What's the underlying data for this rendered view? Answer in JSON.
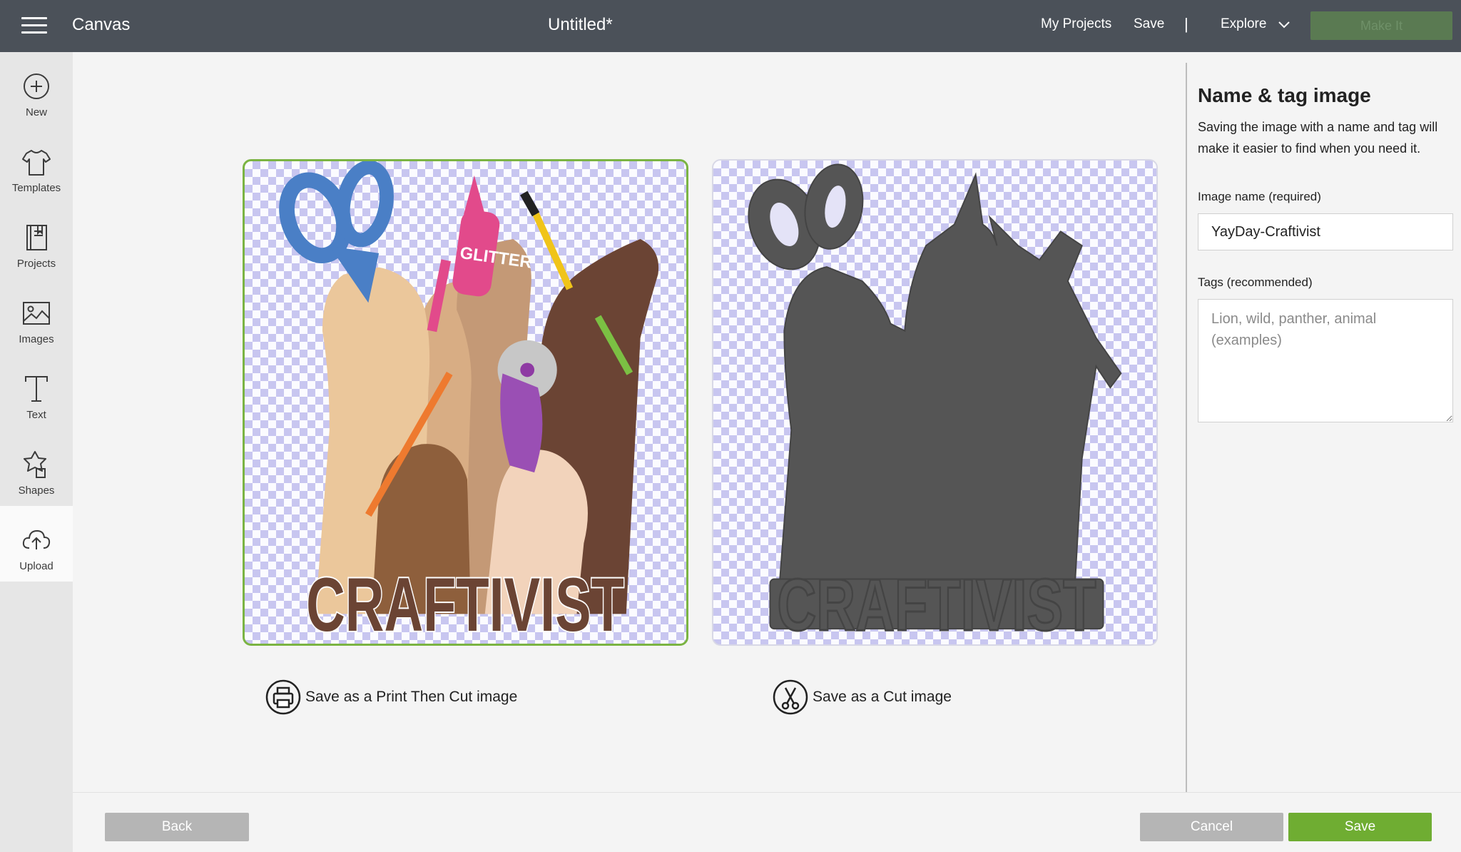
{
  "topbar": {
    "brand": "Canvas",
    "doc_title": "Untitled*",
    "my_projects": "My Projects",
    "save": "Save",
    "separator": "|",
    "explore": "Explore",
    "make_it": "Make It"
  },
  "sidebar": {
    "items": [
      {
        "label": "New",
        "icon": "plus-circle-icon"
      },
      {
        "label": "Templates",
        "icon": "tshirt-icon"
      },
      {
        "label": "Projects",
        "icon": "book-icon"
      },
      {
        "label": "Images",
        "icon": "image-icon"
      },
      {
        "label": "Text",
        "icon": "text-t-icon"
      },
      {
        "label": "Shapes",
        "icon": "shapes-icon"
      },
      {
        "label": "Upload",
        "icon": "cloud-upload-icon"
      }
    ],
    "active": "Upload"
  },
  "main": {
    "print_option_label": "Save as a Print Then Cut image",
    "cut_option_label": "Save as a Cut image",
    "artwork_text": "CRAFTIVIST",
    "bottle_text": "GLITTER",
    "selected_option": "print-then-cut"
  },
  "panel": {
    "title": "Name & tag image",
    "description": "Saving the image with a name and tag will make it easier to find when you need it.",
    "name_label": "Image name (required)",
    "name_value": "YayDay-Craftivist",
    "tags_label": "Tags (recommended)",
    "tags_placeholder": "Lion, wild, panther, animal (examples)"
  },
  "footer": {
    "back": "Back",
    "cancel": "Cancel",
    "save": "Save"
  },
  "colors": {
    "topbar": "#4b5159",
    "accent_green": "#6fad32",
    "selected_border": "#7bb443",
    "silhouette": "#555555"
  }
}
